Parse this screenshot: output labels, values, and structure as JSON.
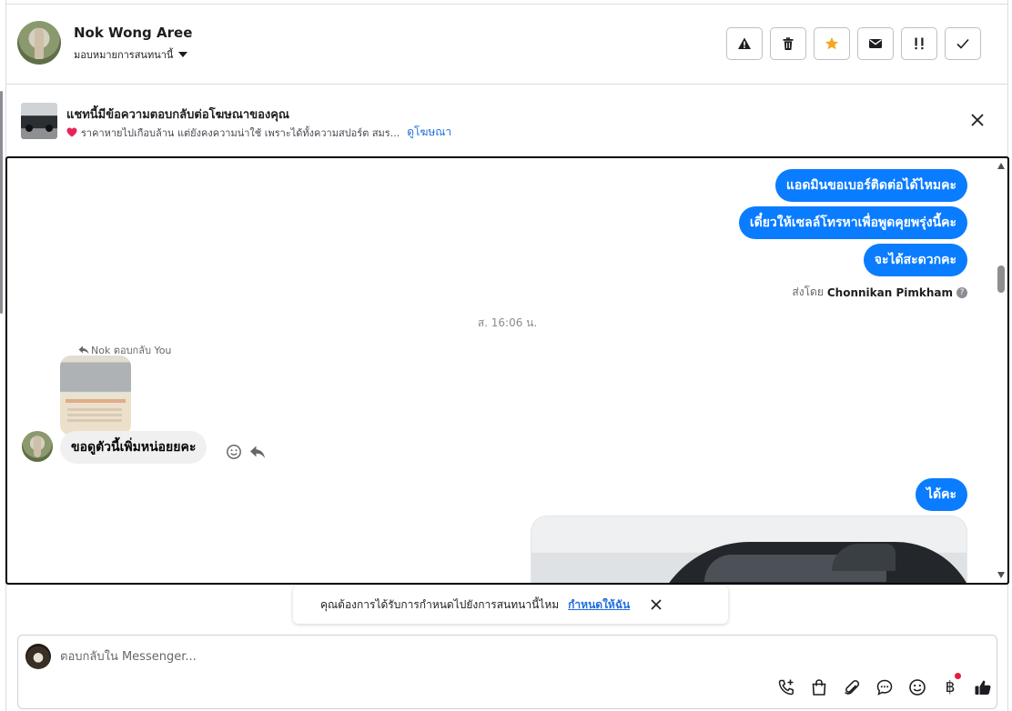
{
  "header": {
    "contact_name": "Nok Wong Aree",
    "assign_label": "มอบหมายการสนทนานี้"
  },
  "ad_banner": {
    "title": "แชทนี้มีข้อความตอบกลับต่อโฆษณาของคุณ",
    "description": "ราคาหายไปเกือบล้าน แต่ยังคงความน่าใช้ เพราะได้ทั้งความสปอร์ต สมร...",
    "link_label": "ดูโฆษณา"
  },
  "conversation": {
    "outgoing_top": [
      "แอดมินขอเบอร์ติดต่อได้ไหมคะ",
      "เดี๋ยวให้เซลล์โทรหาเพื่อพูดคุยพรุ่งนี้คะ",
      "จะได้สะดวกคะ"
    ],
    "sent_by_prefix": "ส่งโดย",
    "sent_by_name": "Chonnikan Pimkham",
    "timestamp": "ส. 16:06 น.",
    "reply_label": "Nok ตอบกลับ You",
    "incoming_message": "ขอดูตัวนี้เพิ่มหน่อยยคะ",
    "outgoing_bottom": "ได้คะ"
  },
  "followup_prompt": {
    "text": "คุณต้องการได้รับการกำหนดไปยังการสนทนานี้ไหม",
    "link_label": "กำหนดให้ฉัน"
  },
  "composer": {
    "placeholder": "ตอบกลับใน Messenger..."
  },
  "icons": {
    "toolbar": [
      "warning-icon",
      "trash-icon",
      "star-icon",
      "envelope-icon",
      "important-icon",
      "check-icon"
    ],
    "composer": [
      "phone-plus-icon",
      "shopping-bag-icon",
      "paperclip-icon",
      "chat-bubble-icon",
      "emoji-icon",
      "baht-icon",
      "thumbs-up-icon"
    ]
  },
  "colors": {
    "accent": "#0a7cff",
    "star": "#f5a623",
    "link": "#216fdb",
    "notification": "#e41e3f"
  }
}
